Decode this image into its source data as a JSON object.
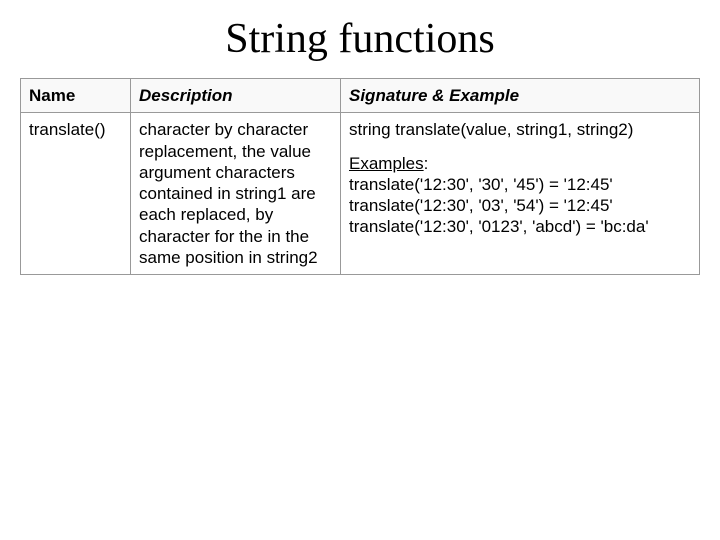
{
  "title": "String functions",
  "table": {
    "headers": {
      "name": "Name",
      "description": "Description",
      "signature": "Signature & Example"
    },
    "row": {
      "name": "translate()",
      "description": "character by character replacement, the value argument characters contained in string1 are each replaced, by character for the in the same position in string2",
      "signature": "string translate(value, string1, string2)",
      "examples_label": "Examples",
      "examples_colon": ":",
      "examples": [
        "translate('12:30', '30', '45') = '12:45'",
        "translate('12:30', '03', '54') = '12:45'",
        "translate('12:30', '0123', 'abcd') = 'bc:da'"
      ]
    }
  }
}
